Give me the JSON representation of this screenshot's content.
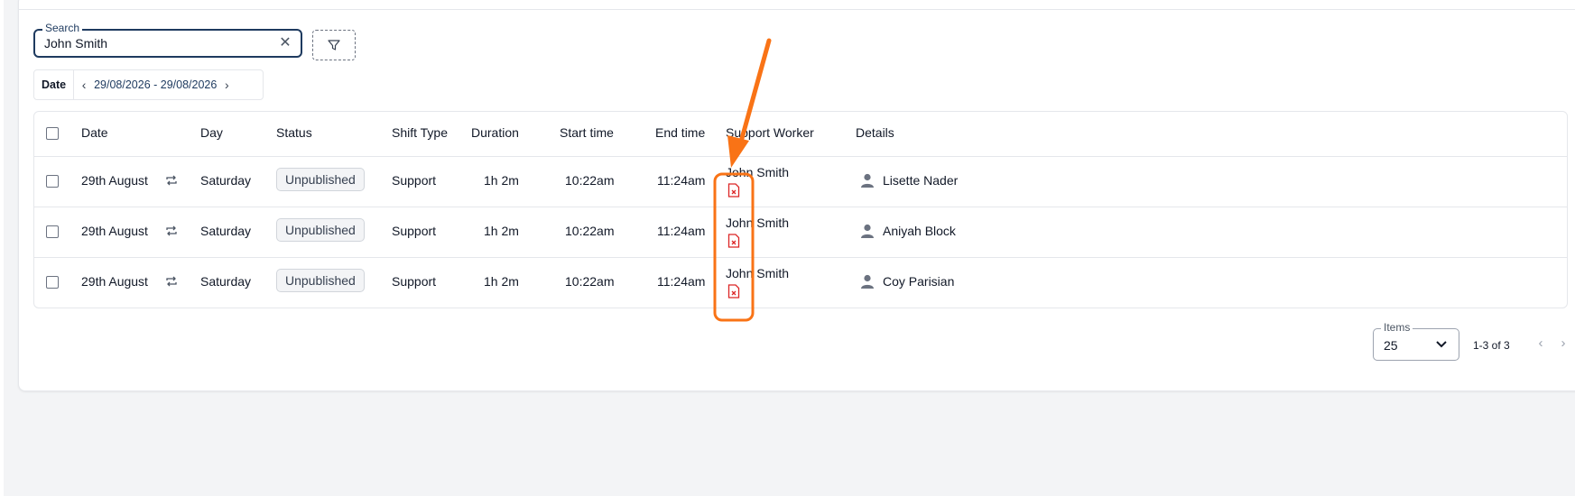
{
  "search": {
    "legend": "Search",
    "value": "John Smith"
  },
  "date_filter": {
    "label": "Date",
    "range": "29/08/2026 - 29/08/2026"
  },
  "table": {
    "headers": [
      "Date",
      "Day",
      "Status",
      "Shift Type",
      "Duration",
      "Start time",
      "End time",
      "Support Worker",
      "Details"
    ],
    "rows": [
      {
        "date": "29th August",
        "day": "Saturday",
        "status": "Unpublished",
        "shift_type": "Support",
        "duration": "1h 2m",
        "start": "10:22am",
        "end": "11:24am",
        "worker": "John Smith",
        "details": "Lisette Nader"
      },
      {
        "date": "29th August",
        "day": "Saturday",
        "status": "Unpublished",
        "shift_type": "Support",
        "duration": "1h 2m",
        "start": "10:22am",
        "end": "11:24am",
        "worker": "John Smith",
        "details": "Aniyah Block"
      },
      {
        "date": "29th August",
        "day": "Saturday",
        "status": "Unpublished",
        "shift_type": "Support",
        "duration": "1h 2m",
        "start": "10:22am",
        "end": "11:24am",
        "worker": "John Smith",
        "details": "Coy Parisian"
      }
    ]
  },
  "pagination": {
    "legend": "Items",
    "per_page": "25",
    "range": "1-3 of 3"
  },
  "colors": {
    "accent": "#1e3a5f",
    "annotation": "#f97316",
    "pdf_icon": "#dc2626",
    "badge_bg": "#f3f4f6"
  },
  "icons": [
    "close-icon",
    "filter-icon",
    "chevron-left-icon",
    "chevron-right-icon",
    "repeat-icon",
    "pdf-error-icon",
    "person-icon",
    "chevron-down-icon"
  ]
}
